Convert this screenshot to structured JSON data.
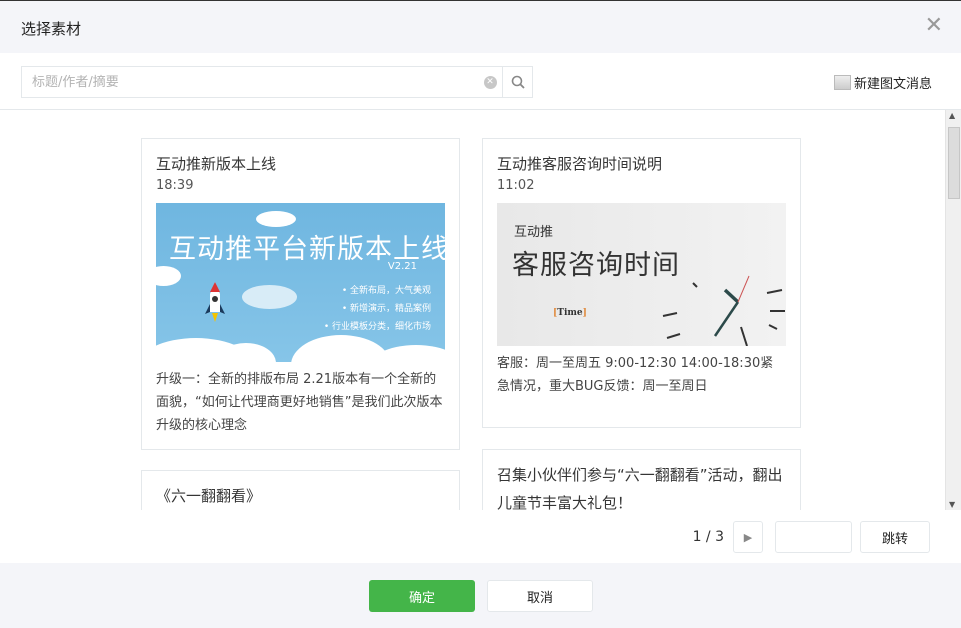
{
  "dialog": {
    "title": "选择素材",
    "close_icon": "close-icon"
  },
  "search": {
    "placeholder": "标题/作者/摘要",
    "value": ""
  },
  "new_message_label": "新建图文消息",
  "cards": [
    {
      "title": "互动推新版本上线",
      "time": "18:39",
      "image": {
        "headline": "互动推平台新版本上线",
        "version": "V2.21",
        "bullets": [
          "• 全新布局，大气美观",
          "• 新增演示，精品案例",
          "• 行业模板分类，细化市场"
        ]
      },
      "desc": "升级一：全新的排版布局 2.21版本有一个全新的面貌，“如何让代理商更好地销售”是我们此次版本升级的核心理念"
    },
    {
      "title": "互动推客服咨询时间说明",
      "time": "11:02",
      "image": {
        "small": "互动推",
        "headline": "客服咨询时间",
        "tag_open": "[",
        "tag": "Time",
        "tag_close": "]"
      },
      "desc": "客服：周一至周五 9:00-12:30 14:00-18:30紧急情况，重大BUG反馈：周一至周日"
    },
    {
      "title": "《六一翻翻看》"
    },
    {
      "title": "召集小伙伴们参与“六一翻翻看”活动，翻出儿童节丰富大礼包！"
    }
  ],
  "pagination": {
    "current": "1 / 3",
    "jump_label": "跳转",
    "jump_value": ""
  },
  "footer": {
    "confirm": "确定",
    "cancel": "取消"
  },
  "colors": {
    "primary": "#44b549",
    "header_bg": "#f4f5f9"
  }
}
